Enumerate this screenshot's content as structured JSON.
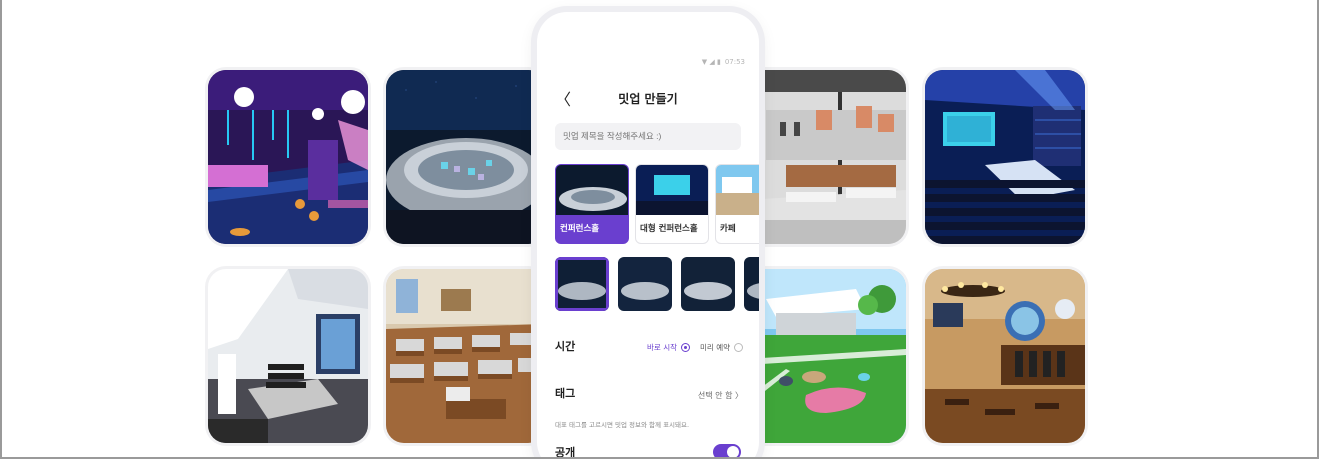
{
  "status_bar": {
    "signal": "▼ ◢ ▮",
    "time": "07:53"
  },
  "header": {
    "back_icon": "chevron-left-icon",
    "title": "밋업 만들기"
  },
  "title_input": {
    "placeholder": "밋업 제목을 작성해주세요 :)"
  },
  "venues": [
    {
      "label": "컨퍼런스홀",
      "selected": true
    },
    {
      "label": "대형 컨퍼런스홀",
      "selected": false
    },
    {
      "label": "카페",
      "selected": false
    }
  ],
  "time": {
    "label": "시간",
    "options": [
      {
        "label": "바로 시작",
        "selected": true
      },
      {
        "label": "미리 예약",
        "selected": false
      }
    ]
  },
  "tag": {
    "label": "태그",
    "select_text": "선택 안 함 〉",
    "hint": "대표 태그를 고르시면 밋업 정보와 함께 표시돼요."
  },
  "public": {
    "label": "공개",
    "on": true
  },
  "colors": {
    "accent": "#6a3fcf"
  },
  "gallery": [
    "club",
    "amphitheater",
    "cafe-lounge",
    "concert-hall",
    "loft-lounge",
    "classroom",
    "stadium-field",
    "tavern"
  ]
}
